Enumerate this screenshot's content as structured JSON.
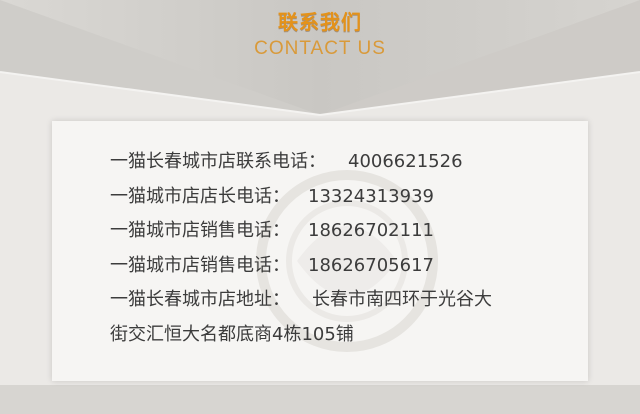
{
  "header": {
    "title_cn": "联系我们",
    "title_en": "CONTACT US"
  },
  "contacts": [
    {
      "label": "一猫长春城市店联系电话：",
      "value": "4006621526"
    },
    {
      "label": "一猫城市店店长电话：",
      "value": "13324313939"
    },
    {
      "label": "一猫城市店销售电话：",
      "value": "18626702111"
    },
    {
      "label": "一猫城市店销售电话：",
      "value": "18626705617"
    }
  ],
  "address": {
    "label": "一猫长春城市店地址：",
    "value_line1": "长春市南四环于光谷大",
    "value_line2": "街交汇恒大名都底商4栋105铺"
  },
  "colors": {
    "accent": "#e4921a",
    "card_bg": "#f6f5f3",
    "text": "#3c3c3c"
  }
}
